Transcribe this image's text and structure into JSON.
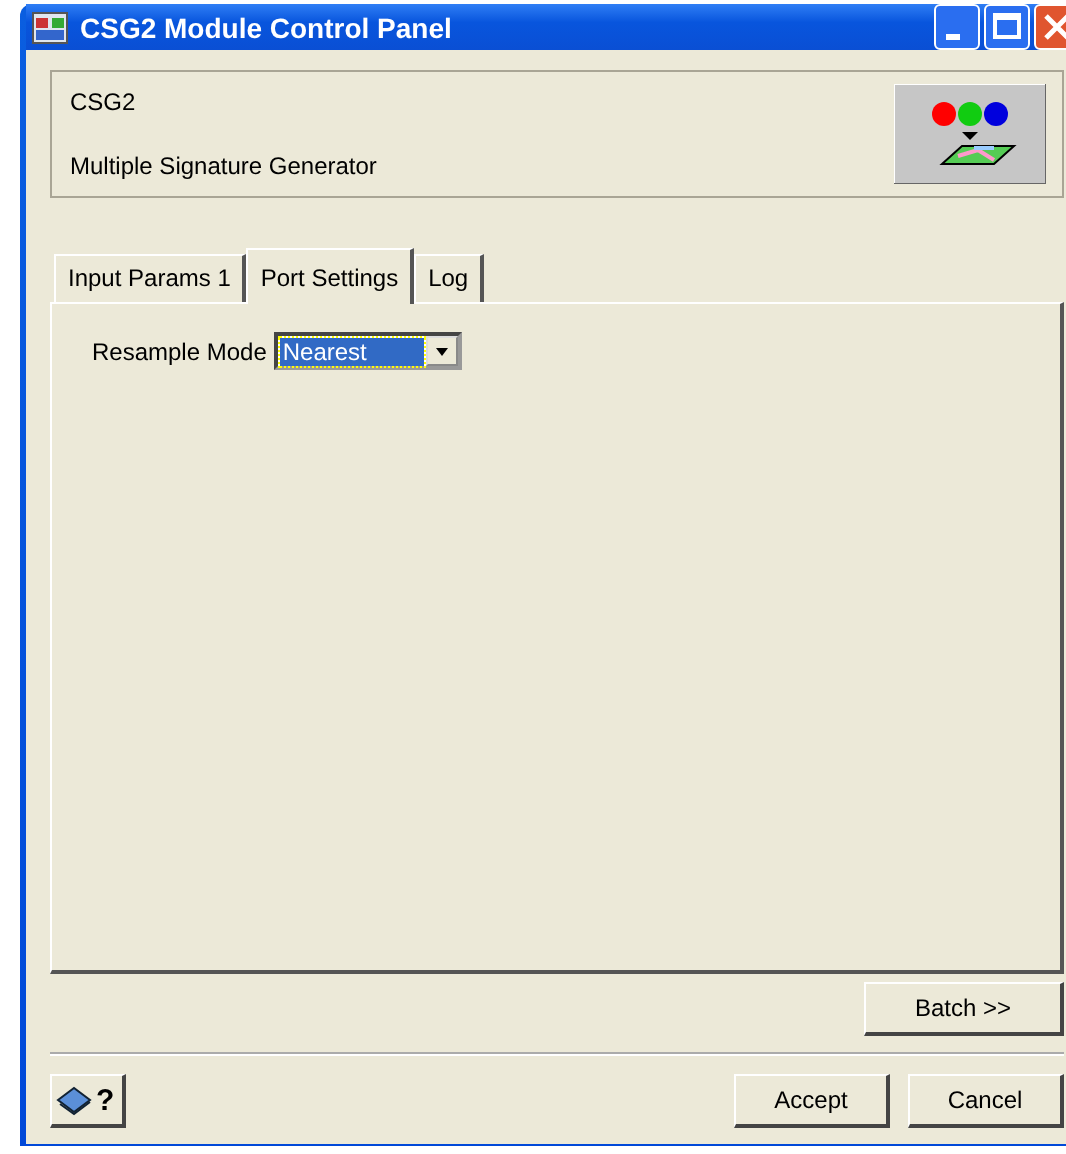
{
  "window": {
    "title": "CSG2 Module Control Panel"
  },
  "header": {
    "name": "CSG2",
    "description": "Multiple Signature Generator"
  },
  "tabs": [
    {
      "label": "Input Params 1",
      "selected": false
    },
    {
      "label": "Port Settings",
      "selected": true
    },
    {
      "label": "Log",
      "selected": false
    }
  ],
  "fields": [
    {
      "label": "Resample Mode",
      "value": "Nearest"
    }
  ],
  "batch_button": "Batch >>",
  "help_button": "?",
  "buttons": [
    "Accept",
    "Cancel"
  ]
}
